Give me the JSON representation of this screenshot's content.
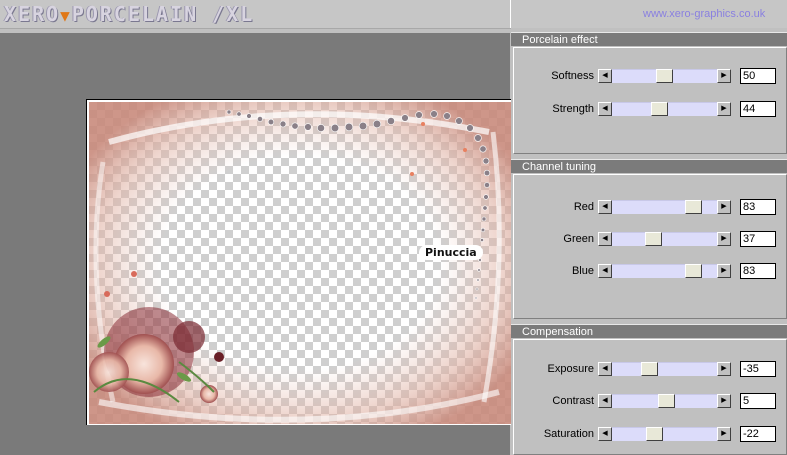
{
  "header": {
    "logo_part1": "XERO",
    "logo_part2": "PORCELAIN /XL",
    "url": "www.xero-graphics.co.uk"
  },
  "preview": {
    "watermark": "Pinuccia"
  },
  "panel": {
    "groups": [
      {
        "title": "Porcelain effect",
        "controls": [
          {
            "label": "Softness",
            "value": "50",
            "level": 0.5
          },
          {
            "label": "Strength",
            "value": "44",
            "level": 0.44
          }
        ]
      },
      {
        "title": "Channel tuning",
        "controls": [
          {
            "label": "Red",
            "value": "83",
            "level": 0.83
          },
          {
            "label": "Green",
            "value": "37",
            "level": 0.37
          },
          {
            "label": "Blue",
            "value": "83",
            "level": 0.83
          }
        ]
      },
      {
        "title": "Compensation",
        "controls": [
          {
            "label": "Exposure",
            "value": "-35",
            "level": 0.325
          },
          {
            "label": "Contrast",
            "value": "5",
            "level": 0.525
          },
          {
            "label": "Saturation",
            "value": "-22",
            "level": 0.39
          }
        ]
      }
    ]
  },
  "icons": {
    "scroll_left": "arrow-left-icon",
    "scroll_right": "arrow-right-icon"
  },
  "colors": {
    "url": "#8a80e0",
    "logo_accent": "#e07818",
    "group_title_bg": "#7b7b7b",
    "slider_track": "#dcdcfa"
  }
}
